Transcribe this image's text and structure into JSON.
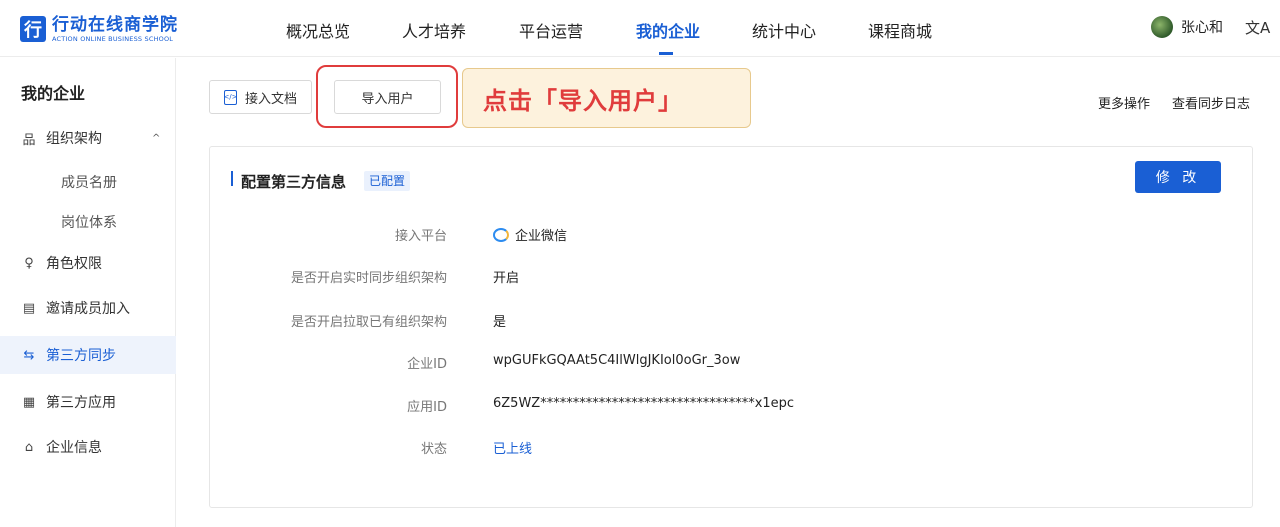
{
  "brand": {
    "logo_mark": "行",
    "name_cn": "行动在线商学院",
    "name_en": "ACTION ONLINE BUSINESS SCHOOL"
  },
  "nav": {
    "items": [
      {
        "label": "概况总览"
      },
      {
        "label": "人才培养"
      },
      {
        "label": "平台运营"
      },
      {
        "label": "我的企业"
      },
      {
        "label": "统计中心"
      },
      {
        "label": "课程商城"
      }
    ],
    "active_index": 3
  },
  "user": {
    "name": "张心和",
    "lang_icon": "文A"
  },
  "sidebar": {
    "title": "我的企业",
    "org": {
      "label": "组织架构",
      "icon": "org-icon",
      "expand_glyph": "^"
    },
    "sub_items": [
      {
        "label": "成员名册"
      },
      {
        "label": "岗位体系"
      }
    ],
    "items": [
      {
        "label": "角色权限",
        "icon": "role-icon"
      },
      {
        "label": "邀请成员加入",
        "icon": "invite-icon"
      },
      {
        "label": "第三方同步",
        "icon": "sync-icon",
        "active": true
      },
      {
        "label": "第三方应用",
        "icon": "apps-icon"
      },
      {
        "label": "企业信息",
        "icon": "home-icon"
      }
    ]
  },
  "toolbar": {
    "doc_button": "接入文档",
    "import_button": "导入用户",
    "callout": "点击「导入用户」",
    "more_actions": "更多操作",
    "sync_log": "查看同步日志"
  },
  "card": {
    "title": "配置第三方信息",
    "status_tag": "已配置",
    "edit_button": "修 改",
    "rows": [
      {
        "label": "接入平台",
        "value": "企业微信"
      },
      {
        "label": "是否开启实时同步组织架构",
        "value": "开启"
      },
      {
        "label": "是否开启拉取已有组织架构",
        "value": "是"
      },
      {
        "label": "企业ID",
        "value": "wpGUFkGQAAt5C4IlWlgJKIol0oGr_3ow"
      },
      {
        "label": "应用ID",
        "value": "6Z5WZ*********************************x1epc"
      },
      {
        "label": "状态",
        "value": "已上线"
      }
    ]
  },
  "colors": {
    "accent": "#1a5fd4",
    "highlight": "#e03c3c",
    "callout_bg": "#fdf2dd"
  }
}
